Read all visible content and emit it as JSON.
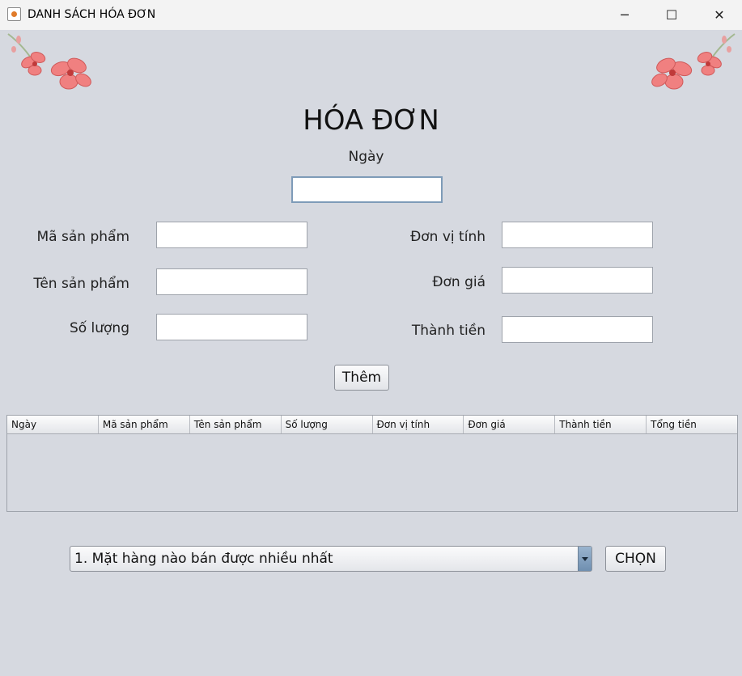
{
  "window": {
    "title": "DANH SÁCH HÓA ĐƠN",
    "minimize": "─",
    "maximize": "☐",
    "close": "✕"
  },
  "form": {
    "heading": "HÓA ĐƠN",
    "date_label": "Ngày",
    "labels": {
      "ma_san_pham": "Mã sản phẩm",
      "ten_san_pham": "Tên sản phẩm",
      "so_luong": "Số lượng",
      "don_vi_tinh": "Đơn vị tính",
      "don_gia": "Đơn giá",
      "thanh_tien": "Thành tiền"
    },
    "values": {
      "ngay": "",
      "ma_san_pham": "",
      "ten_san_pham": "",
      "so_luong": "",
      "don_vi_tinh": "",
      "don_gia": "",
      "thanh_tien": ""
    },
    "add_button": "Thêm"
  },
  "table": {
    "columns": [
      "Ngày",
      "Mã sản phẩm",
      "Tên sản phẩm",
      "Số lượng",
      "Đơn vị tính",
      "Đơn giá",
      "Thành tiền",
      "Tổng tiền"
    ],
    "rows": []
  },
  "query": {
    "selected": "1. Mặt hàng nào bán được nhiều nhất",
    "choose_button": "CHỌN"
  },
  "colors": {
    "background": "#d6d9e0",
    "flower": "#f08080"
  }
}
